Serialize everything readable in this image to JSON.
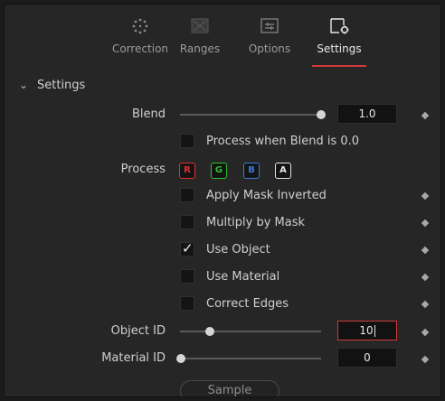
{
  "tabs": [
    {
      "label": "Correction",
      "icon": "correction-dots-icon",
      "active": false
    },
    {
      "label": "Ranges",
      "icon": "ranges-icon",
      "active": false
    },
    {
      "label": "Options",
      "icon": "options-icon",
      "active": false
    },
    {
      "label": "Settings",
      "icon": "settings-gear-icon",
      "active": true
    }
  ],
  "section": {
    "title": "Settings",
    "expanded": true
  },
  "blend": {
    "label": "Blend",
    "value": "1.0",
    "level": 1.0
  },
  "process_when_blend": {
    "label": "Process when Blend is 0.0",
    "checked": false
  },
  "process": {
    "label": "Process",
    "channels": [
      {
        "label": "R",
        "color": "#e03030"
      },
      {
        "label": "G",
        "color": "#2fbf2f"
      },
      {
        "label": "B",
        "color": "#3a7bd8"
      },
      {
        "label": "A",
        "color": "#e6e6e6"
      }
    ]
  },
  "options": [
    {
      "label": "Apply Mask Inverted",
      "checked": false
    },
    {
      "label": "Multiply by Mask",
      "checked": false
    },
    {
      "label": "Use Object",
      "checked": true
    },
    {
      "label": "Use Material",
      "checked": false
    },
    {
      "label": "Correct Edges",
      "checked": false
    }
  ],
  "object_id": {
    "label": "Object ID",
    "value": "10",
    "focused": true
  },
  "material_id": {
    "label": "Material ID",
    "value": "0"
  },
  "sample_button": {
    "label": "Sample"
  },
  "colors": {
    "accent": "#d03a3a",
    "panel": "#262626",
    "field": "#121212"
  }
}
